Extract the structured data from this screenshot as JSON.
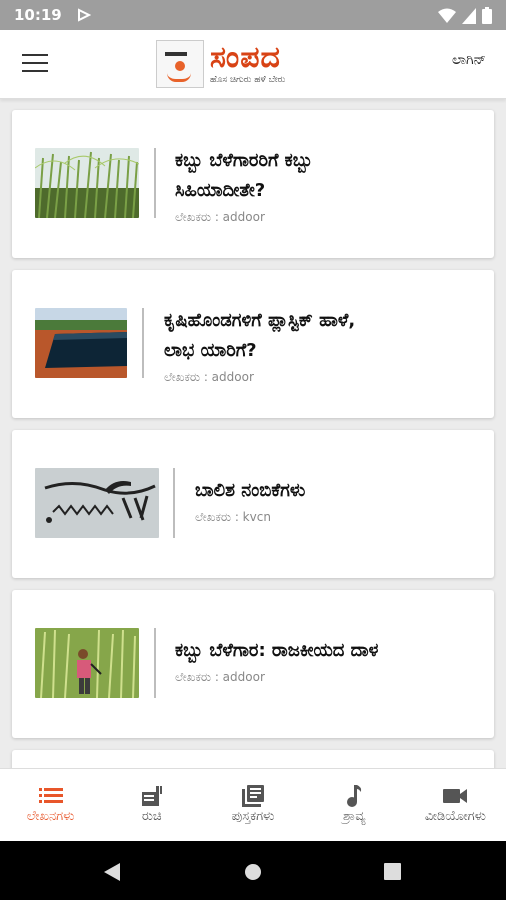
{
  "status": {
    "time": "10:19"
  },
  "header": {
    "logo_title": "ಸಂಪದ",
    "logo_tagline": "ಹೊಸ ಚಿಗುರು ಹಳೆ ಬೇರು",
    "login_label": "ಲಾಗಿನ್"
  },
  "articles": [
    {
      "title_line1": "ಕಬ್ಬು ಬೆಳೆಗಾರರಿಗೆ ಕಬ್ಬು",
      "title_line2": "ಸಿಹಿಯಾದೀತೇ?",
      "author": "ಲೇಖಕರು : addoor",
      "image": "sugarcane-field-icon"
    },
    {
      "title_line1": "ಕೃಷಿಹೊಂಡಗಳಿಗೆ ಪ್ಲಾಸ್ಟಿಕ್ ಹಾಳೆ,",
      "title_line2": "ಲಾಭ ಯಾರಿಗೆ?",
      "author": "ಲೇಖಕರು : addoor",
      "image": "farm-pond-icon"
    },
    {
      "title_line1": "ಬಾಲಿಶ ನಂಬಿಕೆಗಳು",
      "title_line2": "",
      "author": "ಲೇಖಕರು : kvcn",
      "image": "wall-drawing-icon"
    },
    {
      "title_line1": "ಕಬ್ಬು ಬೆಳೆಗಾರ: ರಾಜಕೀಯದ ದಾಳ",
      "title_line2": "",
      "author": "ಲೇಖಕರು : addoor",
      "image": "farmer-sugarcane-icon"
    }
  ],
  "nav": {
    "items": [
      {
        "label": "ಲೇಖನಗಳು",
        "icon": "list-icon",
        "active": true
      },
      {
        "label": "ರುಚಿ",
        "icon": "recipe-icon",
        "active": false
      },
      {
        "label": "ಪುಸ್ತಕಗಳು",
        "icon": "books-icon",
        "active": false
      },
      {
        "label": "ಶ್ರಾವ್ಯ",
        "icon": "music-note-icon",
        "active": false
      },
      {
        "label": "ವೀಡಿಯೋಗಳು",
        "icon": "video-camera-icon",
        "active": false
      }
    ]
  },
  "colors": {
    "accent": "#e8562a",
    "logo": "#d84315",
    "statusbar": "#9e9e9e"
  }
}
